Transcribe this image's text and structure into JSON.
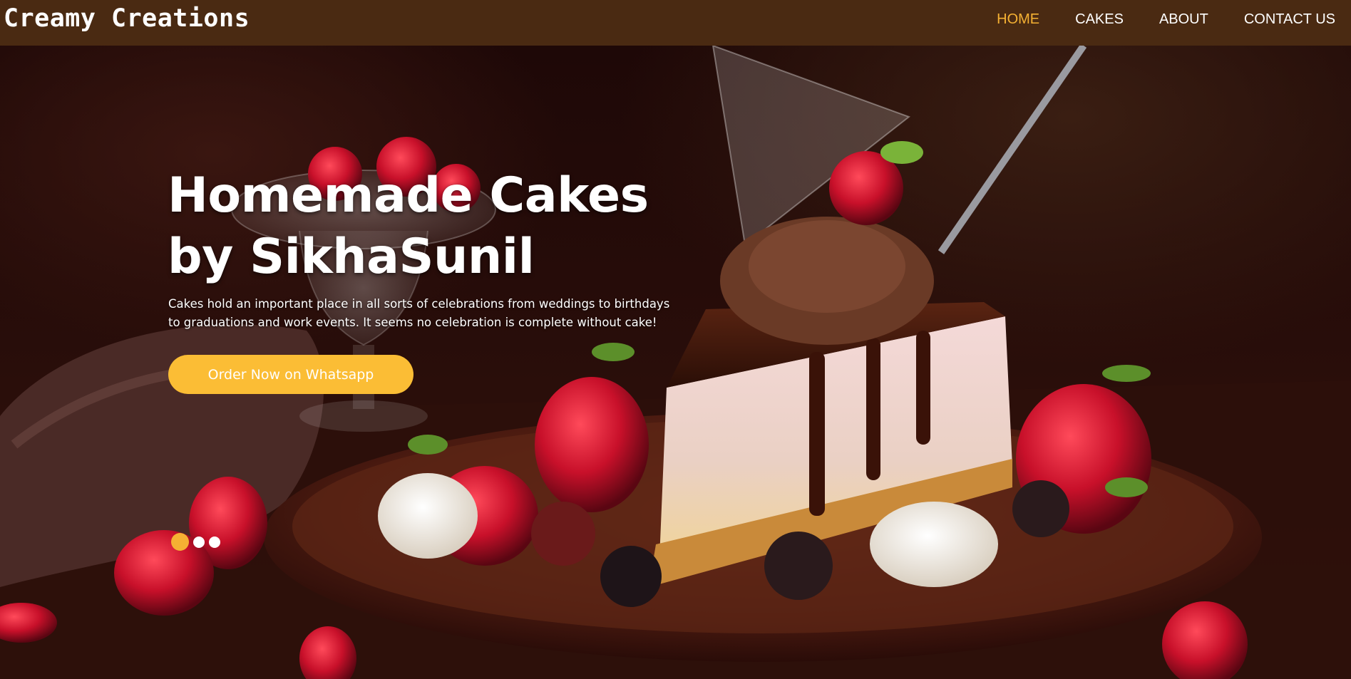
{
  "brand": {
    "name": "Creamy Creations"
  },
  "nav": {
    "items": [
      {
        "label": "HOME",
        "active": true
      },
      {
        "label": "CAKES",
        "active": false
      },
      {
        "label": "ABOUT",
        "active": false
      },
      {
        "label": "CONTACT US",
        "active": false
      }
    ]
  },
  "hero": {
    "title": "Homemade Cakes by SikhaSunil",
    "description": "Cakes hold an important place in all sorts of celebrations from weddings to birthdays to graduations and work events. It seems no celebration is complete without cake!",
    "cta_label": "Order Now on Whatsapp",
    "carousel": {
      "slides": 3,
      "active_index": 0
    }
  },
  "colors": {
    "navbar_bg": "#4a2a12",
    "accent": "#f5b133",
    "button_bg": "#fbbd35",
    "text": "#ffffff"
  }
}
